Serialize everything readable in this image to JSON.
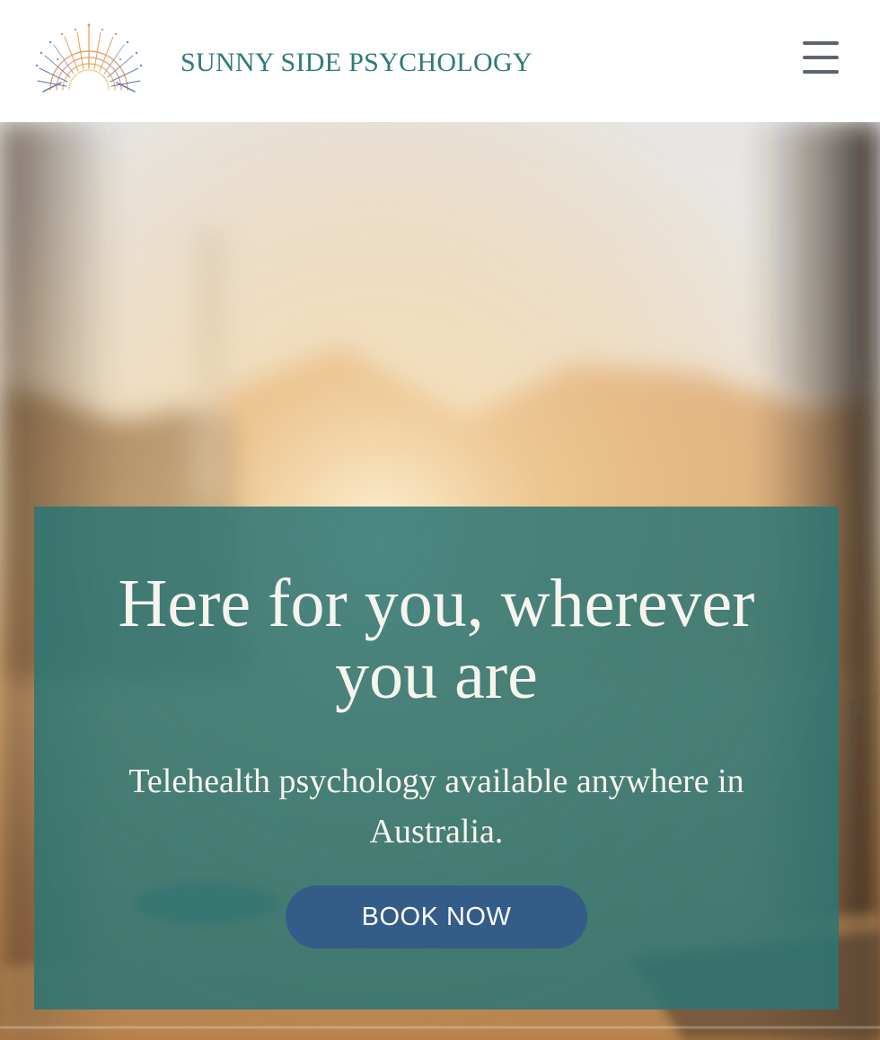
{
  "header": {
    "logo_icon": "sunburst-logo-icon",
    "site_name": "SUNNY SIDE PSYCHOLOGY",
    "menu_icon": "hamburger-menu-icon"
  },
  "hero": {
    "background_image": "blurred sunset coffee cup laptop photo",
    "title": "Here for you, wherever you are",
    "subtitle": "Telehealth psychology available anywhere in Australia.",
    "cta_label": "BOOK NOW"
  },
  "colors": {
    "brand_teal": "#2f7a7a",
    "card_teal": "#2c7674",
    "button_blue": "#335c89",
    "menu_gray": "#5d6570"
  }
}
